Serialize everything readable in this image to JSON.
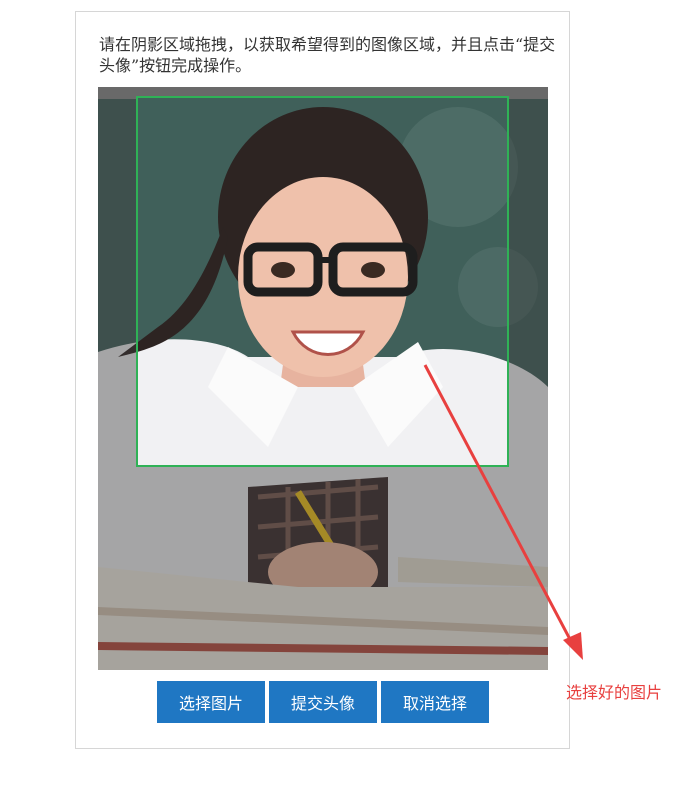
{
  "instructions": "请在阴影区域拖拽，以获取希望得到的图像区域，并且点击“提交头像”按钮完成操作。",
  "buttons": {
    "select_image": "选择图片",
    "submit_avatar": "提交头像",
    "cancel_selection": "取消选择"
  },
  "annotation": {
    "label": "选择好的图片",
    "color": "#e8403f"
  },
  "colors": {
    "button": "#1f77c3",
    "crop_border": "#2fb256"
  }
}
